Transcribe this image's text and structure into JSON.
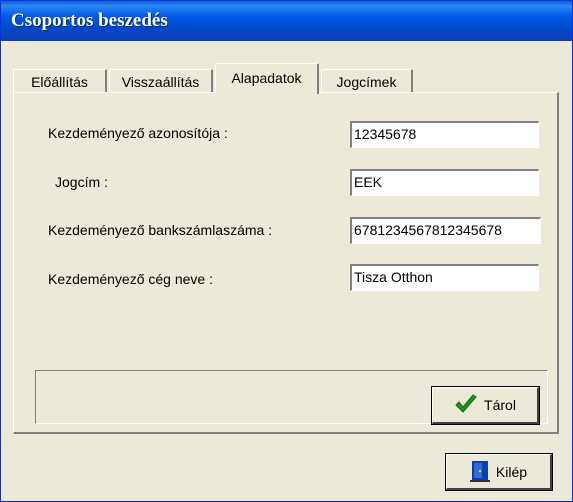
{
  "window": {
    "title": "Csoportos beszedés"
  },
  "tabs": [
    {
      "label": "Előállítás"
    },
    {
      "label": "Visszaállítás"
    },
    {
      "label": "Alapadatok"
    },
    {
      "label": "Jogcímek"
    }
  ],
  "form": {
    "fields": [
      {
        "label": "Kezdeményező azonosítója :",
        "value": "12345678"
      },
      {
        "label": "Jogcím :",
        "value": "EEK"
      },
      {
        "label": "Kezdeményező bankszámlaszáma :",
        "value": "6781234567812345678"
      },
      {
        "label": "Kezdeményező cég neve :",
        "value": "Tisza Otthon"
      }
    ]
  },
  "buttons": {
    "save": "Tárol",
    "exit": "Kilép"
  },
  "icons": {
    "save": "checkmark-icon",
    "exit": "exit-door-icon"
  },
  "colors": {
    "titlebar": "#0058e6",
    "face": "#ece9d8",
    "check": "#1a9a1a"
  }
}
